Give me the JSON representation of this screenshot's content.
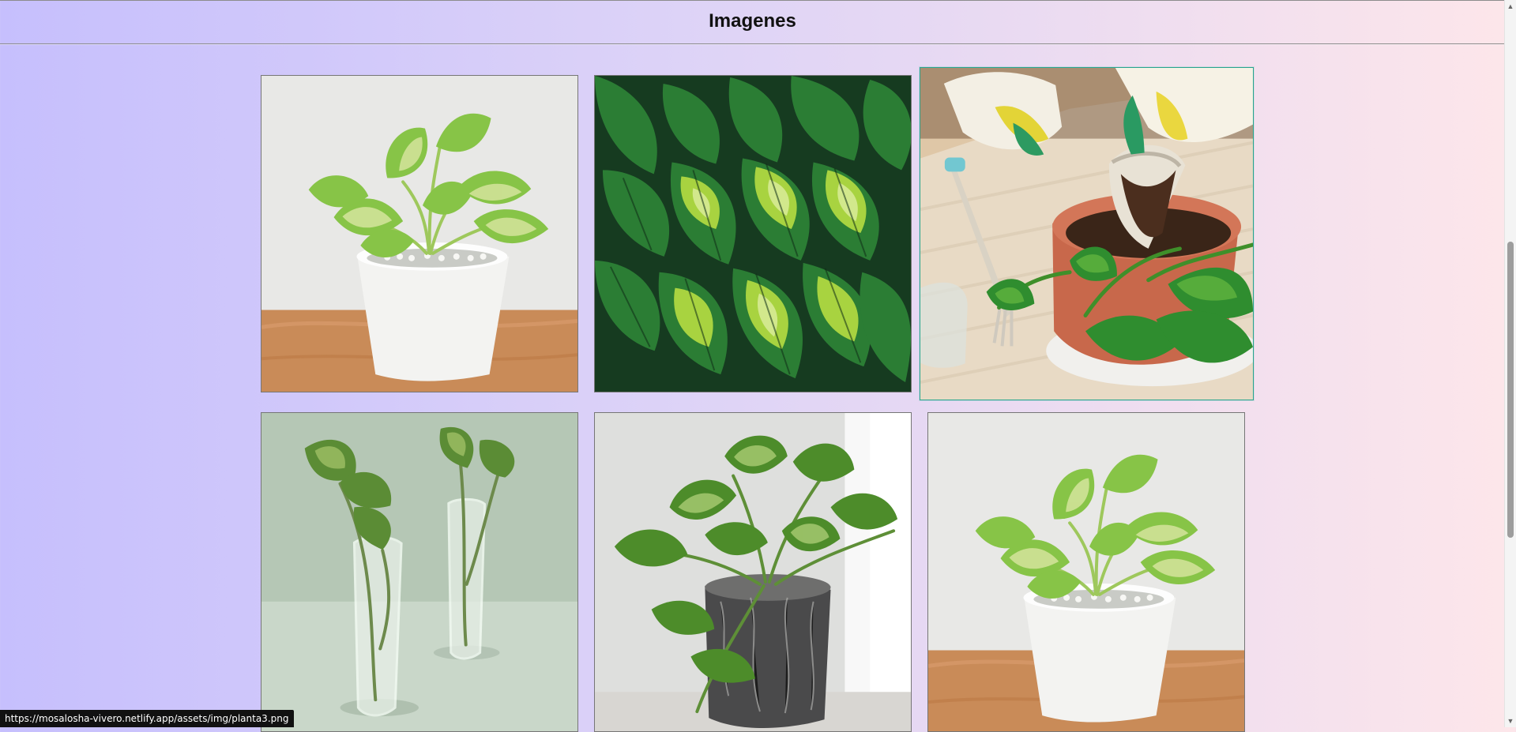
{
  "header": {
    "title": "Imagenes"
  },
  "gallery": {
    "images": [
      {
        "subject": "pothos-white-pot-icon"
      },
      {
        "subject": "pothos-leaves-icon"
      },
      {
        "subject": "repotting-pothos-icon"
      },
      {
        "subject": "pothos-water-vases-icon"
      },
      {
        "subject": "pothos-gray-pot-icon"
      },
      {
        "subject": "pothos-white-pot-icon"
      }
    ]
  },
  "status_bar": {
    "url": "https://mosalosha-vivero.netlify.app/assets/img/planta3.png"
  },
  "colors": {
    "background_left": "#c6bffd",
    "background_right": "#fde6ea",
    "focus_border": "#27a58f"
  }
}
